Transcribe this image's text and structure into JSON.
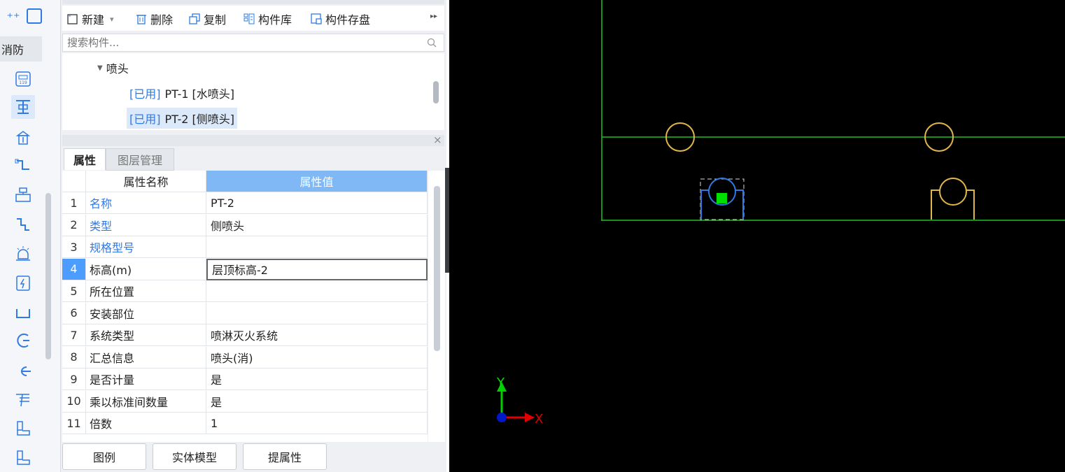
{
  "strip": {
    "category": "消防",
    "icons": [
      "fire-alarm-icon",
      "sprinkler-icon",
      "hydrant-icon",
      "pipe-icon",
      "valve-group-icon",
      "pipe-fitting-icon",
      "alarm-bell-icon",
      "electrical-box-icon",
      "tray-icon",
      "elbow-icon",
      "nozzle-icon",
      "manifold-icon",
      "equipment-icon",
      "equipment-icon-2"
    ]
  },
  "toolbar": {
    "new_label": "新建",
    "delete_label": "删除",
    "copy_label": "复制",
    "library_label": "构件库",
    "save_label": "构件存盘",
    "more": "▸▸"
  },
  "search": {
    "placeholder": "搜索构件..."
  },
  "tree": {
    "group": "喷头",
    "items": [
      {
        "tag": "[已用]",
        "label": "PT-1 [水喷头]"
      },
      {
        "tag": "[已用]",
        "label": "PT-2 [侧喷头]"
      }
    ]
  },
  "panel_close": "×",
  "tabs": {
    "properties": "属性",
    "layers": "图层管理"
  },
  "table": {
    "col_name": "属性名称",
    "col_value": "属性值",
    "rows": [
      {
        "no": "1",
        "name": "名称",
        "value": "PT-2"
      },
      {
        "no": "2",
        "name": "类型",
        "value": "侧喷头"
      },
      {
        "no": "3",
        "name": "规格型号",
        "value": ""
      },
      {
        "no": "4",
        "name": "标高(m)",
        "value": "层顶标高-2"
      },
      {
        "no": "5",
        "name": "所在位置",
        "value": ""
      },
      {
        "no": "6",
        "name": "安装部位",
        "value": ""
      },
      {
        "no": "7",
        "name": "系统类型",
        "value": "喷淋灭火系统"
      },
      {
        "no": "8",
        "name": "汇总信息",
        "value": "喷头(消)"
      },
      {
        "no": "9",
        "name": "是否计量",
        "value": "是"
      },
      {
        "no": "10",
        "name": "乘以标准间数量",
        "value": "是"
      },
      {
        "no": "11",
        "name": "倍数",
        "value": "1"
      }
    ]
  },
  "bottom": {
    "legend": "图例",
    "solid_model": "实体模型",
    "extract": "提属性"
  },
  "viewport": {
    "axis_x": "X",
    "axis_y": "Y",
    "colors": {
      "grid": "#1fbf1f",
      "sprinkler": "#e1b64a",
      "selected": "#2f7ae5",
      "marker": "#00e000"
    }
  }
}
